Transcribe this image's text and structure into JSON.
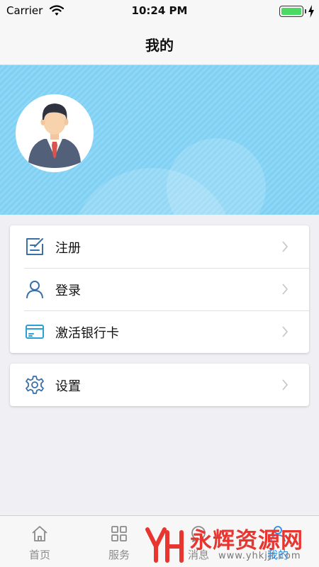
{
  "status_bar": {
    "carrier": "Carrier",
    "time": "10:24 PM",
    "battery_level": 1.0
  },
  "nav": {
    "title": "我的"
  },
  "account_menu": [
    {
      "icon": "register-form-icon",
      "label": "注册"
    },
    {
      "icon": "user-icon",
      "label": "登录"
    },
    {
      "icon": "bank-card-icon",
      "label": "激活银行卡"
    }
  ],
  "settings_menu": [
    {
      "icon": "gear-icon",
      "label": "设置"
    }
  ],
  "tab_bar": {
    "tabs": [
      {
        "icon": "home-icon",
        "label": "首页"
      },
      {
        "icon": "grid-icon",
        "label": "服务"
      },
      {
        "icon": "message-icon",
        "label": "消息"
      },
      {
        "icon": "profile-icon",
        "label": "我的"
      }
    ],
    "active_index": 3
  },
  "watermark": {
    "title": "永辉资源网",
    "url": "www.yhkjjt.com"
  },
  "colors": {
    "hero_background": "#85d3f4",
    "icon_blue": "#3a6fa8",
    "tab_active": "#2b8ce6",
    "tab_inactive": "#8a8a8a",
    "watermark_red": "#e8352f"
  }
}
